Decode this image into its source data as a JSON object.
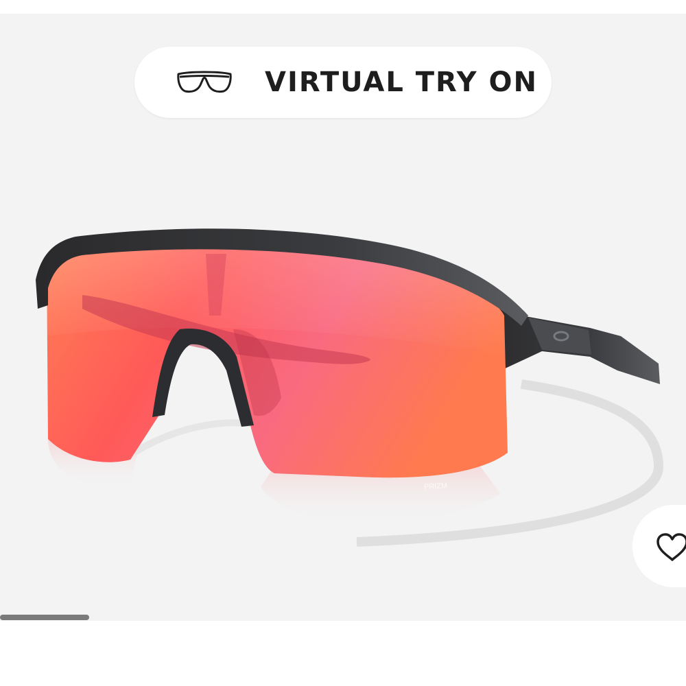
{
  "try_on": {
    "label": "VIRTUAL TRY ON",
    "icon": "glasses-outline-icon"
  },
  "product": {
    "image_alt": "Sunglasses with matte black frame and red-pink shield lens",
    "lens_mark": "PRIZM",
    "frame_color": "#2b2b2d",
    "lens_colors": [
      "#ff6b4a",
      "#f7667a",
      "#ff7b52"
    ]
  },
  "favorite": {
    "icon": "heart-outline-icon"
  },
  "carousel": {
    "current_index": 1,
    "progress_fraction": 0.13
  }
}
